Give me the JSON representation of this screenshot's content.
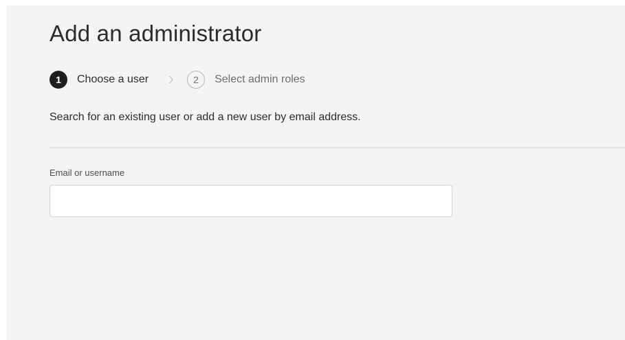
{
  "dialog": {
    "title": "Add an administrator",
    "background_color": "#f4f4f4"
  },
  "stepper": {
    "steps": [
      {
        "number": "1",
        "label": "Choose a user",
        "state": "active"
      },
      {
        "number": "2",
        "label": "Select admin roles",
        "state": "inactive"
      }
    ],
    "separator_icon": "chevron-right-icon"
  },
  "description": "Search for an existing user or add a new user by email address.",
  "email_field": {
    "label": "Email or username",
    "value": "",
    "placeholder": ""
  }
}
